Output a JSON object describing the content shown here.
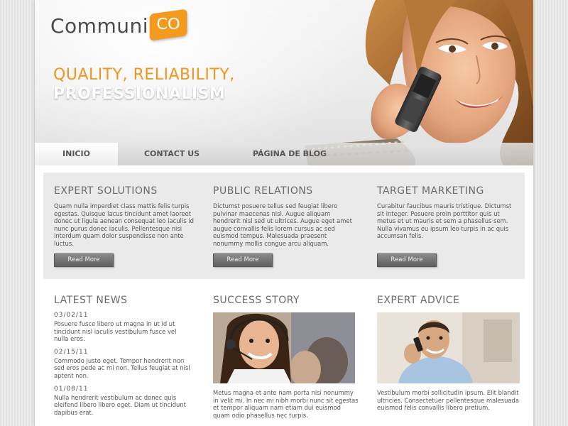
{
  "logo": {
    "text": "Communi",
    "badge": "CO"
  },
  "tagline": {
    "line1": "QUALITY, RELIABILITY,",
    "line2": "PROFESSIONALISM"
  },
  "nav": {
    "items": [
      {
        "label": "INICIO",
        "active": true
      },
      {
        "label": "CONTACT US",
        "active": false
      },
      {
        "label": "PÁGINA DE BLOG",
        "active": false
      }
    ]
  },
  "features": [
    {
      "title": "EXPERT SOLUTIONS",
      "text": "Quam nulla imperdiet class mattis felis turpis egestas. Quisque lacus tincidunt amet laoreet donec ut ligula aenean consequat leo iaculis id nunc purus donec iaculis. Pellentesque nisi interdum quam dolor suspendisse non ante luctus.",
      "button": "Read More"
    },
    {
      "title": "PUBLIC RELATIONS",
      "text": "Dictumst posuere tellus sed feugiat libero pulvinar maecenas nisl. Augue aliquam hendrerit nisl sed ut ultrices. Augue eget amet augue convallis felis lorem cursus ac sed euismod tempus. Malesuada praesent nonummy mollis congue arcu aliquam.",
      "button": "Read More"
    },
    {
      "title": "TARGET MARKETING",
      "text": "Curabitur faucibus mauris tristique. Dictumst sit integer. Posuere proin porttitor quis ut metus et ut mauris et sem a phasellus sem. Nulla vivamus eu ipsum leo turpis in ac quis accumsan felis.",
      "button": "Read More"
    }
  ],
  "latest_news": {
    "title": "LATEST NEWS",
    "items": [
      {
        "date": "03/02/11",
        "text": "Posuere fusce libero ut magna in ut id ut tincidunt nisl iaculis vestibulum fusce vel nulla eros."
      },
      {
        "date": "02/15/11",
        "text": "Commodo justo eget. Tempor hendrerit non sed eros pede ac mi non. Tellus feugiat at nisl aptent non."
      },
      {
        "date": "01/08/11",
        "text": "Nulla hendrerit vestibulum ac donec quis eleifend libero libero eget. Diam ut tincidunt dapibus erat."
      }
    ]
  },
  "success_story": {
    "title": "SUCCESS STORY",
    "text": "Metus magna et ante nam porta nisi nonummy in velit mi. In nec mi nibh morbi nunc sit egestas et tempor aliquam nam etiam dui euismod quam odio phasellus nec turpis."
  },
  "expert_advice": {
    "title": "EXPERT ADVICE",
    "text": "Vestibulum morbi sollicitudin ipsum. Elit blandit ultricies. Consectetuer pellentesque malesuada euismod felis convallis libero pretium."
  },
  "colors": {
    "accent": "#f0961f",
    "text": "#555555",
    "heading": "#6a6a6a",
    "panel": "#eaeaea"
  }
}
